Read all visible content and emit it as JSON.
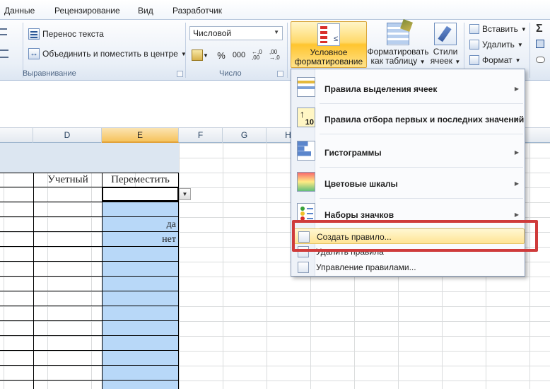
{
  "tabs": [
    "Данные",
    "Рецензирование",
    "Вид",
    "Разработчик"
  ],
  "alignment": {
    "wrap_text": "Перенос текста",
    "merge_center": "Объединить и поместить в центре",
    "group_label": "Выравнивание"
  },
  "number": {
    "format_value": "Числовой",
    "percent": "%",
    "thousands": "000",
    "inc_decimal": "←,0 ,00",
    "dec_decimal": ",00 →,0",
    "group_label": "Число"
  },
  "styles": {
    "conditional_line1": "Условное",
    "conditional_line2": "форматирование",
    "format_table_line1": "Форматировать",
    "format_table_line2": "как таблицу",
    "cell_styles_line1": "Стили",
    "cell_styles_line2": "ячеек"
  },
  "cells": {
    "insert": "Вставить",
    "delete": "Удалить",
    "format": "Формат",
    "sum_symbol": "Σ"
  },
  "sheet": {
    "columns": [
      "D",
      "E",
      "F",
      "G",
      "H"
    ],
    "header_d": "Учетный",
    "header_e": "Переместить",
    "values": [
      "да",
      "нет"
    ]
  },
  "menu": {
    "items": [
      {
        "label": "Правила выделения ячеек",
        "icon": "highlight-rules-icon"
      },
      {
        "label": "Правила отбора первых и последних значений",
        "icon": "top-bottom-rules-icon"
      },
      {
        "label": "Гистограммы",
        "icon": "data-bars-icon"
      },
      {
        "label": "Цветовые шкалы",
        "icon": "color-scales-icon"
      },
      {
        "label": "Наборы значков",
        "icon": "icon-sets-icon"
      }
    ],
    "new_rule": "Создать правило...",
    "clear_rules": "Удалить правила",
    "manage_rules": "Управление правилами..."
  },
  "colors": {
    "highlight_box": "#cf3b3b",
    "selected_column_fill": "#b8d8f8",
    "title_band_fill": "#dce6f1",
    "active_button": "#ffd969"
  }
}
